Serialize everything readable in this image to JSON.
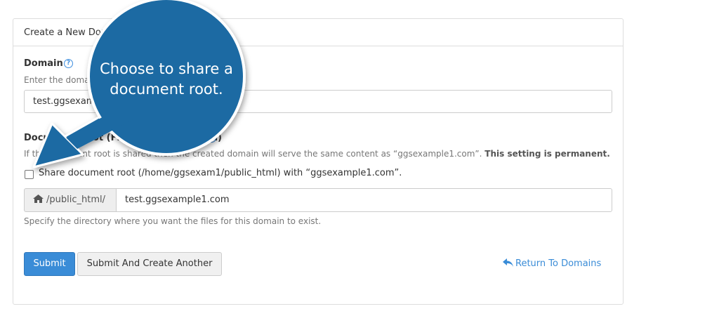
{
  "panel": {
    "title": "Create a New Domain"
  },
  "domain_field": {
    "label": "Domain",
    "help": "Enter the domain that you would like to create:",
    "value": "test.ggsexample1.com"
  },
  "docroot_field": {
    "label": "Document Root (File System Location)",
    "help": "If the document root is shared then the created domain will serve the same content as “ggsexample1.com”.",
    "help_strong": "This setting is permanent.",
    "checkbox_label": "Share document root (/home/ggsexam1/public_html) with “ggsexample1.com”.",
    "checkbox_checked": false,
    "prefix": "/public_html/",
    "value": "test.ggsexample1.com",
    "hint": "Specify the directory where you want the files for this domain to exist."
  },
  "actions": {
    "submit": "Submit",
    "submit_another": "Submit And Create Another",
    "return_link": "Return To Domains"
  },
  "callout": {
    "text": "Choose to share a document root.",
    "color": "#1c6aa3"
  },
  "icons": {
    "help": "question-circle-icon",
    "home": "home-icon",
    "return": "reply-arrow-icon"
  },
  "colors": {
    "primary": "#3a8cd7",
    "link": "#3a8cd7",
    "border": "#dddddd"
  }
}
